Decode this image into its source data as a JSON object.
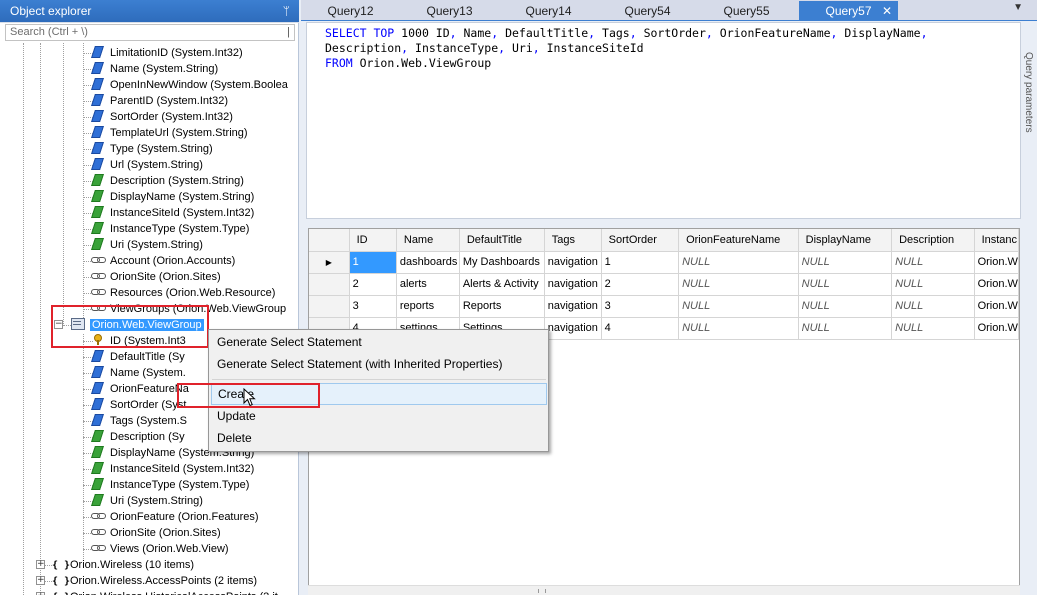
{
  "explorer": {
    "title": "Object explorer",
    "pin_glyph": "ᛘ",
    "search_placeholder": "Search (Ctrl + \\)",
    "search_sep": "|",
    "nodes": [
      {
        "label": "LimitationID (System.Int32)",
        "icon": "prop-blue"
      },
      {
        "label": "Name (System.String)",
        "icon": "prop-blue"
      },
      {
        "label": "OpenInNewWindow (System.Boolea",
        "icon": "prop-blue"
      },
      {
        "label": "ParentID (System.Int32)",
        "icon": "prop-blue"
      },
      {
        "label": "SortOrder (System.Int32)",
        "icon": "prop-blue"
      },
      {
        "label": "TemplateUrl (System.String)",
        "icon": "prop-blue"
      },
      {
        "label": "Type (System.String)",
        "icon": "prop-blue"
      },
      {
        "label": "Url (System.String)",
        "icon": "prop-blue"
      },
      {
        "label": "Description (System.String)",
        "icon": "prop-green"
      },
      {
        "label": "DisplayName (System.String)",
        "icon": "prop-green"
      },
      {
        "label": "InstanceSiteId (System.Int32)",
        "icon": "prop-green"
      },
      {
        "label": "InstanceType (System.Type)",
        "icon": "prop-green"
      },
      {
        "label": "Uri (System.String)",
        "icon": "prop-green"
      },
      {
        "label": "Account (Orion.Accounts)",
        "icon": "link"
      },
      {
        "label": "OrionSite (Orion.Sites)",
        "icon": "link"
      },
      {
        "label": "Resources (Orion.Web.Resource)",
        "icon": "link"
      },
      {
        "label": "ViewGroups (Orion.Web.ViewGroup",
        "icon": "link"
      },
      {
        "label": "Orion.Web.ViewGroup",
        "icon": "entity",
        "selected": true
      },
      {
        "label": "ID (System.Int3",
        "icon": "prop-key"
      },
      {
        "label": "DefaultTitle (Sy",
        "icon": "prop-blue"
      },
      {
        "label": "Name (System.",
        "icon": "prop-blue"
      },
      {
        "label": "OrionFeatureNa",
        "icon": "prop-blue"
      },
      {
        "label": "SortOrder (Syst",
        "icon": "prop-blue"
      },
      {
        "label": "Tags (System.S",
        "icon": "prop-blue"
      },
      {
        "label": "Description (Sy",
        "icon": "prop-green"
      },
      {
        "label": "DisplayName (System.String)",
        "icon": "prop-green"
      },
      {
        "label": "InstanceSiteId (System.Int32)",
        "icon": "prop-green"
      },
      {
        "label": "InstanceType (System.Type)",
        "icon": "prop-green"
      },
      {
        "label": "Uri (System.String)",
        "icon": "prop-green"
      },
      {
        "label": "OrionFeature (Orion.Features)",
        "icon": "link"
      },
      {
        "label": "OrionSite (Orion.Sites)",
        "icon": "link"
      },
      {
        "label": "Views (Orion.Web.View)",
        "icon": "link"
      },
      {
        "label": "Orion.Wireless (10 items)",
        "icon": "ns"
      },
      {
        "label": "Orion.Wireless.AccessPoints (2 items)",
        "icon": "ns"
      },
      {
        "label": "Orion.Wireless.HistoricalAccessPoints (2 it",
        "icon": "ns"
      }
    ],
    "ns_glyph": "{ }",
    "expand_minus": "−",
    "expand_plus": "+"
  },
  "tabs": {
    "items": [
      {
        "label": "Query12",
        "active": false
      },
      {
        "label": "Query13",
        "active": false
      },
      {
        "label": "Query14",
        "active": false
      },
      {
        "label": "Query54",
        "active": false
      },
      {
        "label": "Query55",
        "active": false
      },
      {
        "label": "Query57",
        "active": true
      }
    ],
    "close_glyph": "✕",
    "menu_glyph": "▼"
  },
  "editor": {
    "lines": [
      [
        {
          "t": "SELECT TOP",
          "kw": true
        },
        {
          "t": " 1000 ID",
          "kw": false
        },
        {
          "t": ",",
          "kw": true
        },
        {
          "t": " Name",
          "kw": false
        },
        {
          "t": ",",
          "kw": true
        },
        {
          "t": " DefaultTitle",
          "kw": false
        },
        {
          "t": ",",
          "kw": true
        },
        {
          "t": " Tags",
          "kw": false
        },
        {
          "t": ",",
          "kw": true
        },
        {
          "t": " SortOrder",
          "kw": false
        },
        {
          "t": ",",
          "kw": true
        },
        {
          "t": " OrionFeatureName",
          "kw": false
        },
        {
          "t": ",",
          "kw": true
        },
        {
          "t": " DisplayName",
          "kw": false
        },
        {
          "t": ",",
          "kw": true
        }
      ],
      [
        {
          "t": "Description",
          "kw": false
        },
        {
          "t": ",",
          "kw": true
        },
        {
          "t": " InstanceType",
          "kw": false
        },
        {
          "t": ",",
          "kw": true
        },
        {
          "t": " Uri",
          "kw": false
        },
        {
          "t": ",",
          "kw": true
        },
        {
          "t": " InstanceSiteId",
          "kw": false
        }
      ],
      [
        {
          "t": "FROM",
          "kw": true
        },
        {
          "t": " Orion.Web.ViewGroup",
          "kw": false
        }
      ]
    ]
  },
  "side_label": "Query parameters",
  "grid": {
    "columns": [
      "ID",
      "Name",
      "DefaultTitle",
      "Tags",
      "SortOrder",
      "OrionFeatureName",
      "DisplayName",
      "Description",
      "Instanc"
    ],
    "current_row_marker": "▶",
    "rows": [
      [
        "1",
        "dashboards",
        "My Dashboards",
        "navigation",
        "1",
        "NULL",
        "NULL",
        "NULL",
        "Orion.W"
      ],
      [
        "2",
        "alerts",
        "Alerts & Activity",
        "navigation",
        "2",
        "NULL",
        "NULL",
        "NULL",
        "Orion.W"
      ],
      [
        "3",
        "reports",
        "Reports",
        "navigation",
        "3",
        "NULL",
        "NULL",
        "NULL",
        "Orion.W"
      ],
      [
        "4",
        "settings",
        "Settings",
        "navigation",
        "4",
        "NULL",
        "NULL",
        "NULL",
        "Orion.W"
      ]
    ]
  },
  "context_menu": {
    "items": [
      {
        "label": "Generate Select Statement"
      },
      {
        "label": "Generate Select Statement (with Inherited Properties)"
      },
      {
        "label": "Create"
      },
      {
        "label": "Update"
      },
      {
        "label": "Delete"
      }
    ]
  },
  "colors": {
    "accent": "#3c7fd1",
    "selection": "#3399ff",
    "highlight_box": "#e0222b",
    "keyword": "#0000ff"
  }
}
